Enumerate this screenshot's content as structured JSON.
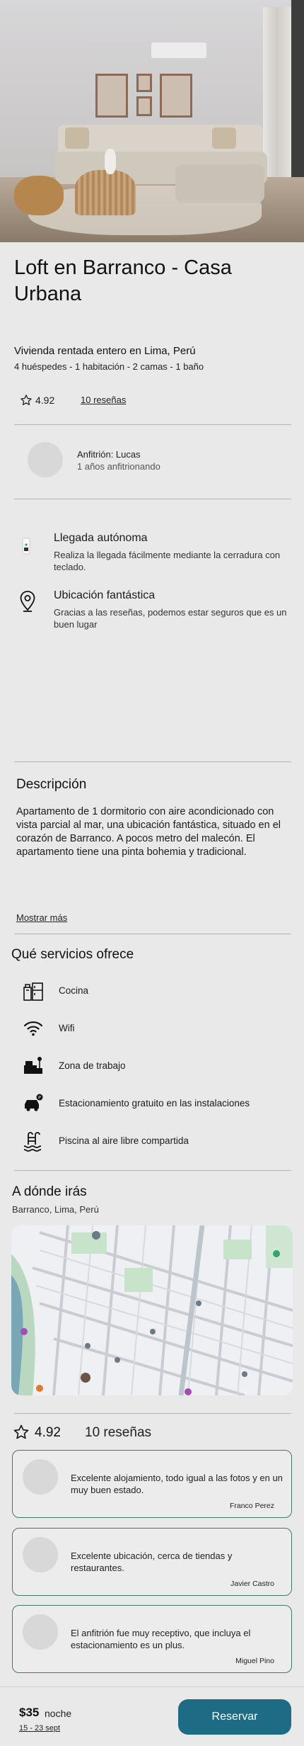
{
  "listing": {
    "title": "Loft en Barranco - Casa Urbana",
    "subtitle": "Vivienda rentada entero en Lima, Perú",
    "details": "4 huéspedes - 1 habitación - 2 camas - 1 baño",
    "rating": "4.92",
    "reviews_link": "10 reseñas"
  },
  "host": {
    "name": "Anfitrión: Lucas",
    "years": "1 años anfitrionando"
  },
  "features": [
    {
      "icon": "door-key-icon",
      "title": "Llegada autónoma",
      "desc": "Realiza la llegada fácilmente mediante la cerradura con teclado."
    },
    {
      "icon": "location-pin-icon",
      "title": "Ubicación fantástica",
      "desc": "Gracias a las reseñas, podemos estar seguros que es un buen lugar"
    }
  ],
  "description": {
    "heading": "Descripción",
    "text": "Apartamento de 1 dormitorio con aire acondicionado con vista parcial al mar, una ubicación fantástica, situado en el corazón de Barranco. A pocos metro del malecón. El apartamento tiene una pinta bohemia y tradicional.",
    "more_link": "Mostrar más"
  },
  "services": {
    "heading": "Qué servicios ofrece",
    "items": [
      {
        "icon": "kitchen-icon",
        "label": "Cocina"
      },
      {
        "icon": "wifi-icon",
        "label": "Wifi"
      },
      {
        "icon": "workspace-icon",
        "label": "Zona de trabajo"
      },
      {
        "icon": "parking-car-icon",
        "label": "Estacionamiento gratuito en las instalaciones"
      },
      {
        "icon": "pool-icon",
        "label": "Piscina al aire libre compartida"
      }
    ]
  },
  "location": {
    "heading": "A dónde irás",
    "address": "Barranco, Lima, Perú"
  },
  "reviews": {
    "rating": "4.92",
    "count_label": "10 reseñas",
    "items": [
      {
        "text": "Excelente alojamiento, todo igual a las fotos y en un muy buen estado.",
        "author": "Franco Perez"
      },
      {
        "text": "Excelente ubicación, cerca de tiendas y restaurantes.",
        "author": "Javier Castro"
      },
      {
        "text": "El anfitrión fue muy receptivo, que incluya el estacionamiento es un plus.",
        "author": "Miguel Pino"
      }
    ]
  },
  "footer": {
    "price": "$35",
    "price_unit": "noche",
    "dates": "15 - 23 sept",
    "book_label": "Reservar"
  },
  "colors": {
    "accent": "#1d6b84",
    "card_border": "#3f7b66",
    "background": "#e9e9e9"
  }
}
